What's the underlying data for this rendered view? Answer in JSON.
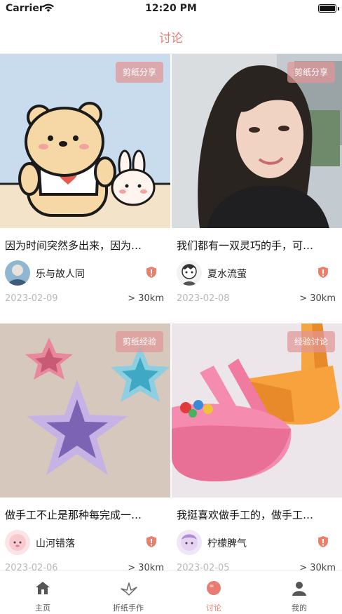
{
  "status_bar": {
    "carrier": "Carrier",
    "time": "12:20 PM"
  },
  "header": {
    "title": "讨论"
  },
  "posts": [
    {
      "tag": "剪纸分享",
      "title": "因为时间突然多出来，因为…",
      "user": "乐与故人同",
      "date": "2023-02-09",
      "distance": "> 30km"
    },
    {
      "tag": "剪纸分享",
      "title": "我们都有一双灵巧的手，可…",
      "user": "夏水流萤",
      "date": "2023-02-08",
      "distance": "> 30km"
    },
    {
      "tag": "剪纸经验",
      "title": "做手工不止是那种每完成一…",
      "user": "山河错落",
      "date": "2023-02-06",
      "distance": "> 30km"
    },
    {
      "tag": "经验讨论",
      "title": "我挺喜欢做手工的，做手工…",
      "user": "柠檬脾气",
      "date": "2023-02-05",
      "distance": "> 30km"
    }
  ],
  "tabs": [
    {
      "label": "主页",
      "icon": "home-icon"
    },
    {
      "label": "折纸手作",
      "icon": "paper-crane-icon"
    },
    {
      "label": "讨论",
      "icon": "discussion-icon"
    },
    {
      "label": "我的",
      "icon": "profile-icon"
    }
  ],
  "active_tab": "讨论",
  "colors": {
    "accent": "#e87c73",
    "tag_bg": "#e3a0a0"
  }
}
